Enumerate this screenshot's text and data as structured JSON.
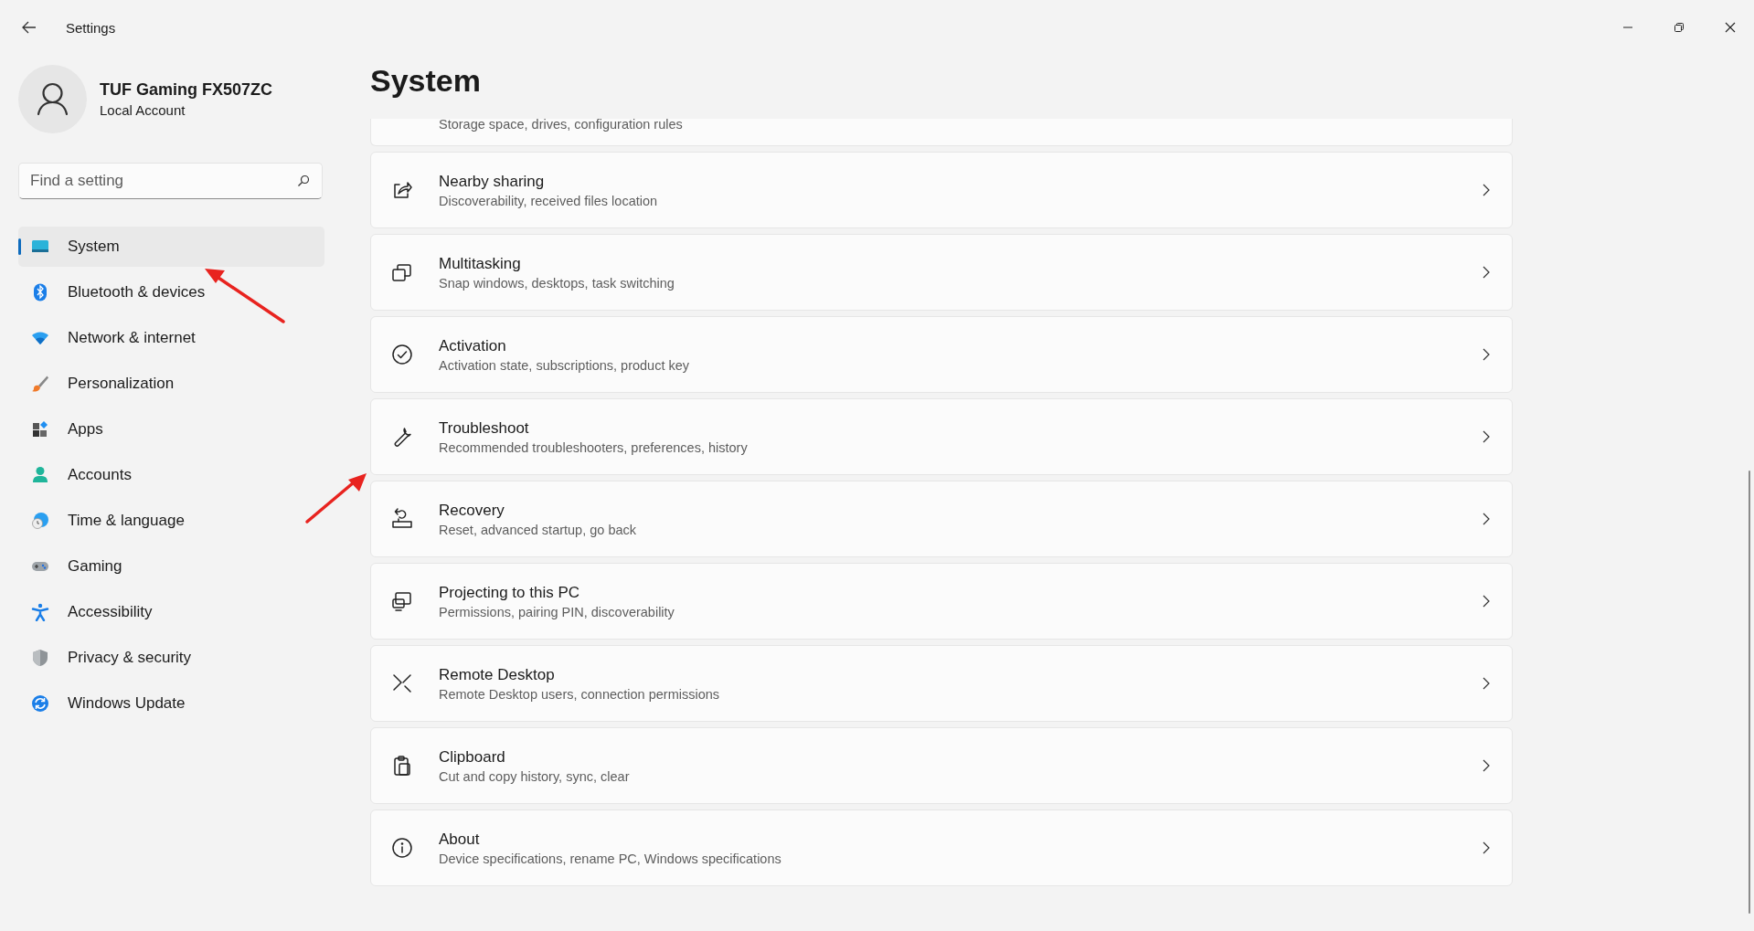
{
  "window": {
    "title": "Settings"
  },
  "account": {
    "name": "TUF Gaming FX507ZC",
    "type": "Local Account"
  },
  "search": {
    "placeholder": "Find a setting"
  },
  "nav": [
    {
      "label": "System",
      "selected": true
    },
    {
      "label": "Bluetooth & devices",
      "selected": false
    },
    {
      "label": "Network & internet",
      "selected": false
    },
    {
      "label": "Personalization",
      "selected": false
    },
    {
      "label": "Apps",
      "selected": false
    },
    {
      "label": "Accounts",
      "selected": false
    },
    {
      "label": "Time & language",
      "selected": false
    },
    {
      "label": "Gaming",
      "selected": false
    },
    {
      "label": "Accessibility",
      "selected": false
    },
    {
      "label": "Privacy & security",
      "selected": false
    },
    {
      "label": "Windows Update",
      "selected": false
    }
  ],
  "page_title": "System",
  "partial_card": {
    "description": "Storage space, drives, configuration rules"
  },
  "cards": [
    {
      "title": "Nearby sharing",
      "description": "Discoverability, received files location"
    },
    {
      "title": "Multitasking",
      "description": "Snap windows, desktops, task switching"
    },
    {
      "title": "Activation",
      "description": "Activation state, subscriptions, product key"
    },
    {
      "title": "Troubleshoot",
      "description": "Recommended troubleshooters, preferences, history"
    },
    {
      "title": "Recovery",
      "description": "Reset, advanced startup, go back"
    },
    {
      "title": "Projecting to this PC",
      "description": "Permissions, pairing PIN, discoverability"
    },
    {
      "title": "Remote Desktop",
      "description": "Remote Desktop users, connection permissions"
    },
    {
      "title": "Clipboard",
      "description": "Cut and copy history, sync, clear"
    },
    {
      "title": "About",
      "description": "Device specifications, rename PC, Windows specifications"
    }
  ]
}
